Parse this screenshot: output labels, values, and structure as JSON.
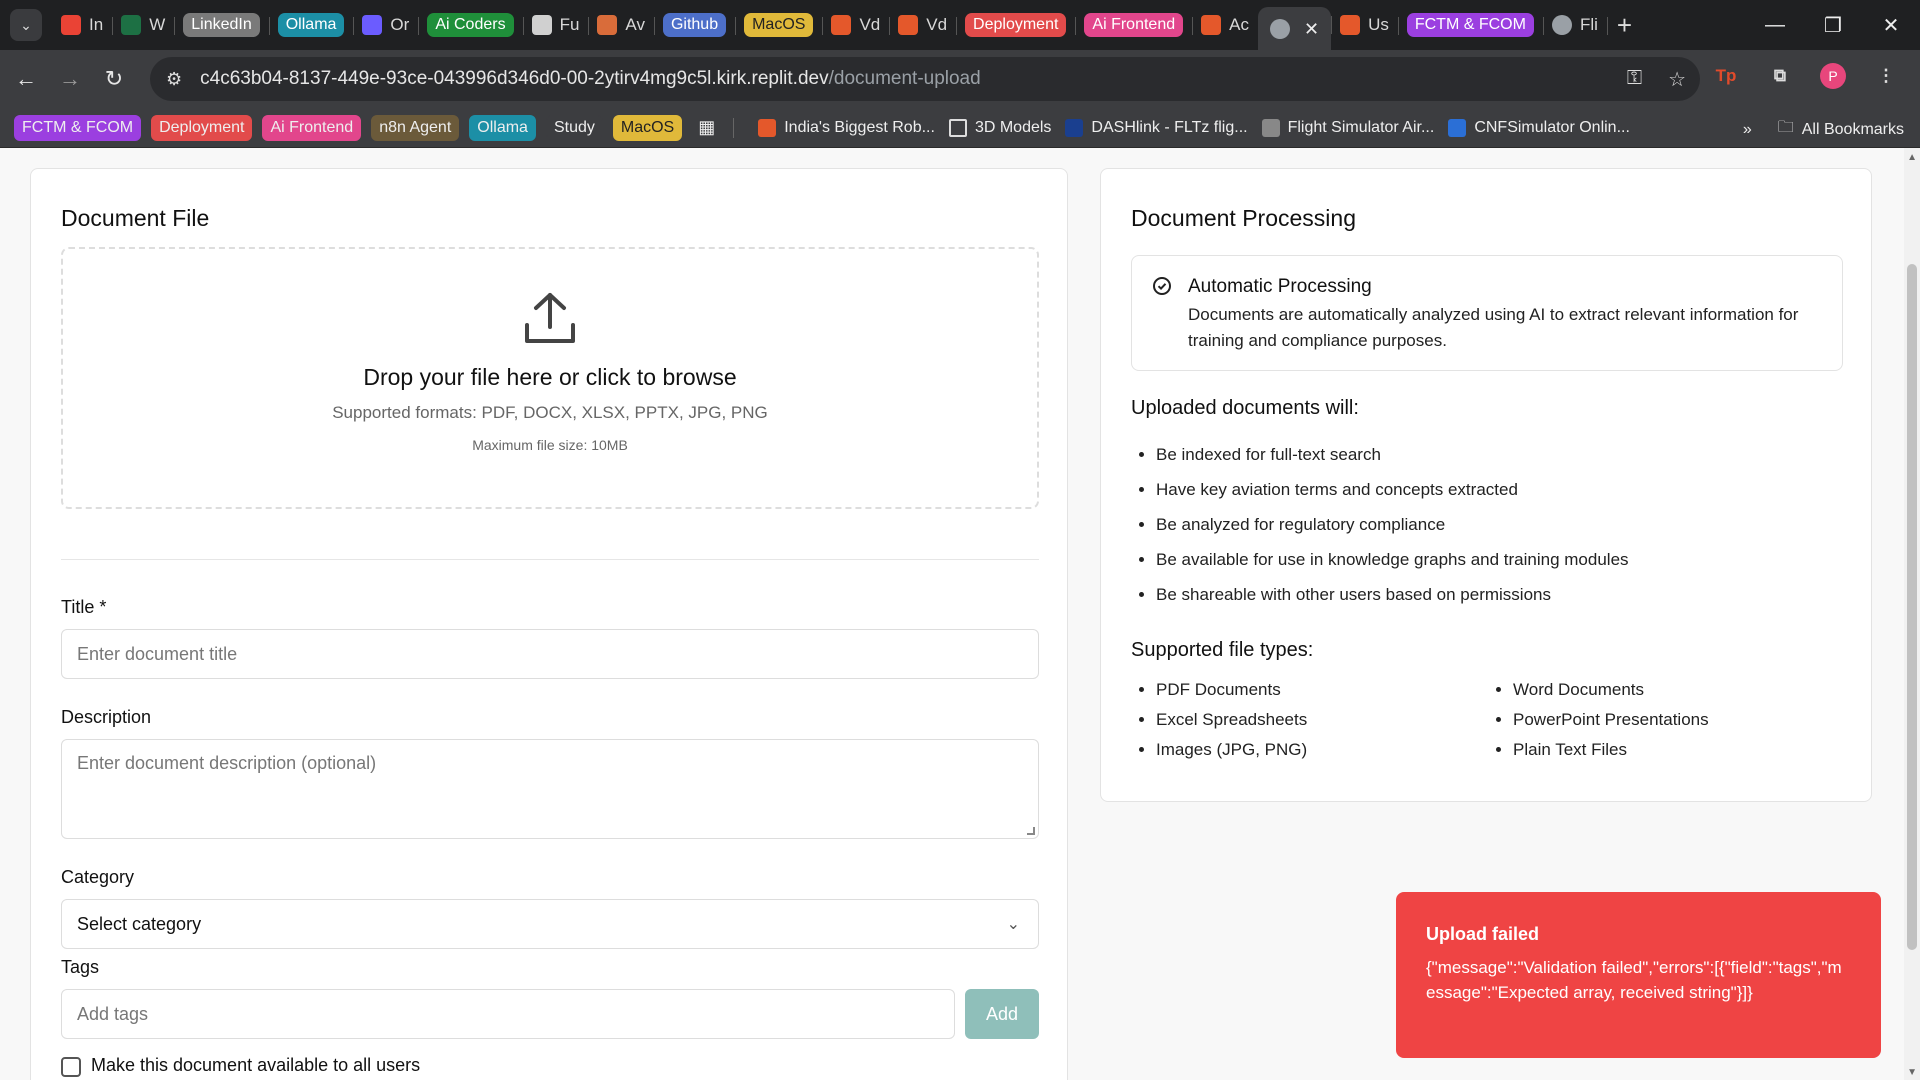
{
  "browser": {
    "tabs": [
      {
        "label": "In",
        "icon": "gmail-icon",
        "color": "#ea4335",
        "pill": false
      },
      {
        "label": "W",
        "icon": "excel-icon",
        "color": "#1d7044",
        "pill": false
      },
      {
        "label": "LinkedIn",
        "icon": "",
        "color": "#7a7a7a",
        "pill": true,
        "textColor": "#ffffff"
      },
      {
        "label": "Ollama",
        "icon": "",
        "color": "#1c8fa6",
        "pill": true,
        "textColor": "#ffffff"
      },
      {
        "label": "Or",
        "icon": "openrouter-icon",
        "color": "#6b5cff",
        "pill": false
      },
      {
        "label": "Ai Coders",
        "icon": "",
        "color": "#1f8f3a",
        "pill": true,
        "textColor": "#ffffff"
      },
      {
        "label": "Fu",
        "icon": "openai-icon",
        "color": "#d0d0d0",
        "pill": false
      },
      {
        "label": "Av",
        "icon": "claude-icon",
        "color": "#d96c3a",
        "pill": false
      },
      {
        "label": "Github",
        "icon": "",
        "color": "#4d6fc9",
        "pill": true,
        "textColor": "#ffffff"
      },
      {
        "label": "MacOS",
        "icon": "",
        "color": "#e0b93a",
        "pill": true,
        "textColor": "#222222"
      },
      {
        "label": "Vd",
        "icon": "replit-icon",
        "color": "#e4582b",
        "pill": false
      },
      {
        "label": "Vd",
        "icon": "replit-icon",
        "color": "#e4582b",
        "pill": false
      },
      {
        "label": "Deployment",
        "icon": "",
        "color": "#e24b4b",
        "pill": true,
        "textColor": "#ffffff"
      },
      {
        "label": "Ai Frontend",
        "icon": "",
        "color": "#e2468c",
        "pill": true,
        "textColor": "#ffffff"
      },
      {
        "label": "Ac",
        "icon": "replit-icon",
        "color": "#e4582b",
        "pill": false
      },
      {
        "label": "",
        "icon": "globe-icon",
        "color": "#9aa0a6",
        "pill": false,
        "active": true
      },
      {
        "label": "Us",
        "icon": "replit-icon",
        "color": "#e4582b",
        "pill": false
      },
      {
        "label": "FCTM & FCOM",
        "icon": "",
        "color": "#9b3fe0",
        "pill": true,
        "textColor": "#ffffff"
      },
      {
        "label": "Fli",
        "icon": "globe-icon",
        "color": "#9aa0a6",
        "pill": false
      }
    ],
    "url_host": "c4c63b04-8137-449e-93ce-043996d346d0-00-2ytirv4mg9c5l.kirk.replit.dev",
    "url_path": "/document-upload",
    "avatar_letter": "P",
    "bookmarks": [
      {
        "label": "FCTM & FCOM",
        "color": "#9b3fe0"
      },
      {
        "label": "Deployment",
        "color": "#e24b4b"
      },
      {
        "label": "Ai Frontend",
        "color": "#e2468c"
      },
      {
        "label": "n8n Agent",
        "color": "#6b5a3a"
      },
      {
        "label": "Ollama",
        "color": "#1c8fa6"
      },
      {
        "label": "Study",
        "color": "#3c3d40"
      },
      {
        "label": "MacOS",
        "color": "#e0b93a"
      }
    ],
    "bookmark_links": [
      {
        "label": "India's Biggest Rob...",
        "icon_color": "#e4582b"
      },
      {
        "label": "3D Models",
        "icon_color": "folder"
      },
      {
        "label": "DASHlink - FLTz flig...",
        "icon_color": "#1a3f8f"
      },
      {
        "label": "Flight Simulator Air...",
        "icon_color": "#888888"
      },
      {
        "label": "CNFSimulator Onlin...",
        "icon_color": "#2b6fd6"
      }
    ],
    "all_bookmarks": "All Bookmarks"
  },
  "left": {
    "heading": "Document File",
    "dropzone": {
      "main": "Drop your file here or click to browse",
      "formats": "Supported formats: PDF, DOCX, XLSX, PPTX, JPG, PNG",
      "max": "Maximum file size: 10MB"
    },
    "title_label": "Title *",
    "title_placeholder": "Enter document title",
    "description_label": "Description",
    "description_placeholder": "Enter document description (optional)",
    "category_label": "Category",
    "category_value": "Select category",
    "tags_label": "Tags",
    "tags_placeholder": "Add tags",
    "add_button": "Add",
    "public_checkbox": "Make this document available to all users"
  },
  "right": {
    "heading": "Document Processing",
    "auto_title": "Automatic Processing",
    "auto_desc": "Documents are automatically analyzed using AI to extract relevant information for training and compliance purposes.",
    "uploaded_heading": "Uploaded documents will:",
    "uploaded_items": [
      "Be indexed for full-text search",
      "Have key aviation terms and concepts extracted",
      "Be analyzed for regulatory compliance",
      "Be available for use in knowledge graphs and training modules",
      "Be shareable with other users based on permissions"
    ],
    "types_heading": "Supported file types:",
    "types_col1": [
      "PDF Documents",
      "Excel Spreadsheets",
      "Images (JPG, PNG)"
    ],
    "types_col2": [
      "Word Documents",
      "PowerPoint Presentations",
      "Plain Text Files"
    ]
  },
  "toast": {
    "title": "Upload failed",
    "message": "{\"message\":\"Validation failed\",\"errors\":[{\"field\":\"tags\",\"message\":\"Expected array, received string\"}]}",
    "color": "#ef4444"
  }
}
